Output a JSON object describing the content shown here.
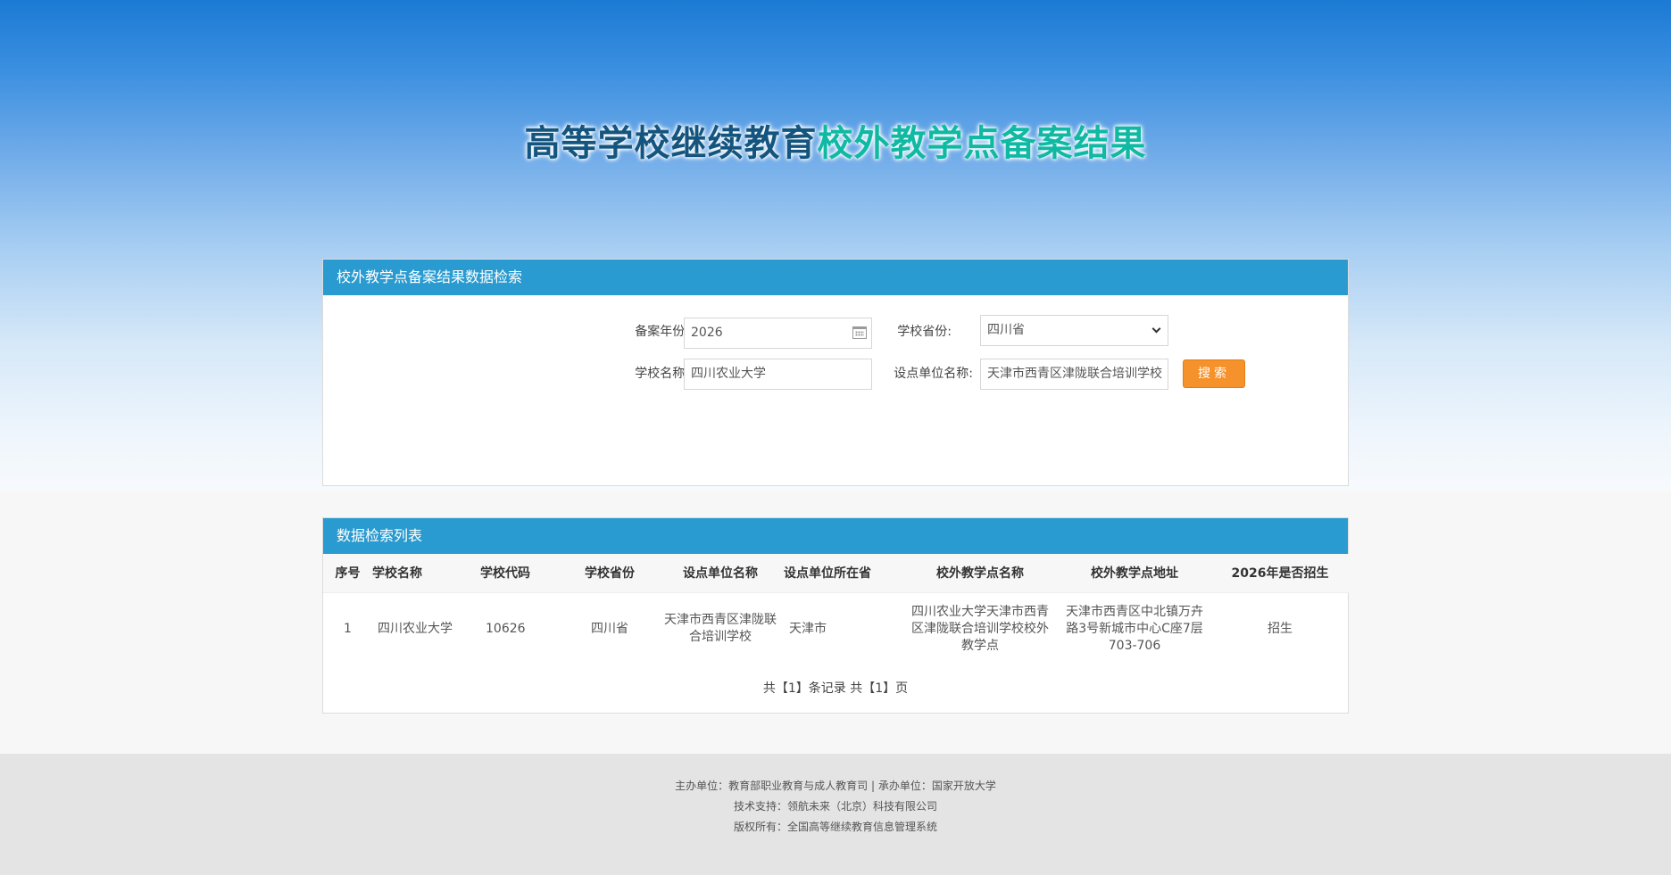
{
  "banner": {
    "title_part1": "高等学校继续教育",
    "title_part2": "校外教学点备案结果"
  },
  "search_panel": {
    "header": "校外教学点备案结果数据检索",
    "year_label": "备案年份:",
    "year_value": "2026",
    "province_label": "学校省份:",
    "province_value": "四川省",
    "school_label": "学校名称:",
    "school_value": "四川农业大学",
    "unit_label": "设点单位名称:",
    "unit_value": "天津市西青区津陇联合培训学校",
    "search_button": "搜索"
  },
  "list_panel": {
    "header": "数据检索列表",
    "columns": [
      "序号",
      "学校名称",
      "学校代码",
      "学校省份",
      "设点单位名称",
      "设点单位所在省",
      "校外教学点名称",
      "校外教学点地址",
      "2026年是否招生"
    ],
    "rows": [
      [
        "1",
        "四川农业大学",
        "10626",
        "四川省",
        "天津市西青区津陇联合培训学校",
        "天津市",
        "四川农业大学天津市西青区津陇联合培训学校校外教学点",
        "天津市西青区中北镇万卉路3号新城市中心C座7层703-706",
        "招生"
      ]
    ],
    "pager": "共【1】条记录 共【1】页"
  },
  "footer": {
    "line1": "主办单位：教育部职业教育与成人教育司 | 承办单位：国家开放大学",
    "line2": "技术支持：领航未来（北京）科技有限公司",
    "line3": "版权所有：全国高等继续教育信息管理系统"
  }
}
